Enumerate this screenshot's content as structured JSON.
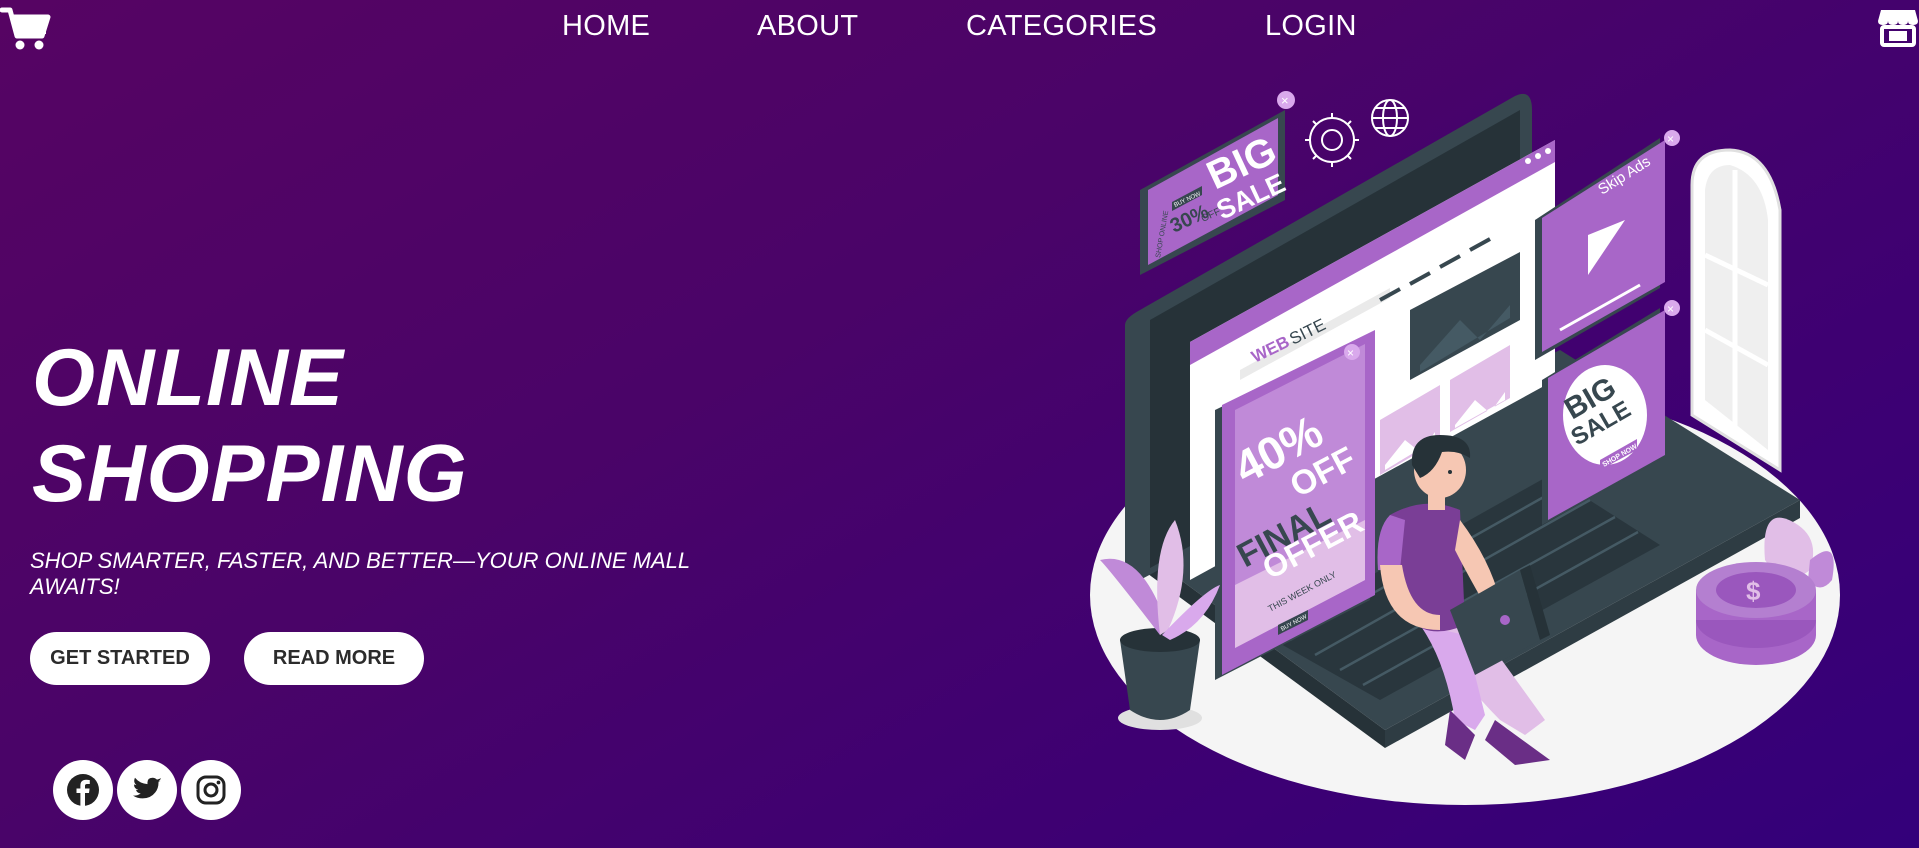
{
  "nav": {
    "home": "HOME",
    "about": "ABOUT",
    "categories": "CATEGORIES",
    "login": "LOGIN"
  },
  "hero": {
    "title_line1": "ONLINE",
    "title_line2": "SHOPPING",
    "tagline": "SHOP SMARTER, FASTER, AND BETTER—YOUR ONLINE MALL AWAITS!",
    "get_started": "GET STARTED",
    "read_more": "READ MORE"
  },
  "illustration": {
    "top_ad_big": "BIG",
    "top_ad_sale": "SALE",
    "top_ad_buy": "BUY NOW",
    "top_ad_percent": "30%",
    "top_ad_off": "OFF",
    "top_ad_side": "SHOP ONLINE",
    "browser_label_web": "WEB",
    "browser_label_site": "SITE",
    "skip_ads": "Skip Ads",
    "offer_percent": "40%",
    "offer_off": "OFF",
    "offer_final": "FINAL",
    "offer_word": "OFFER",
    "offer_week": "THIS WEEK ONLY",
    "offer_buy": "BUY NOW",
    "badge_big": "BIG",
    "badge_sale": "SALE",
    "badge_shop": "SHOP NOW",
    "coin_symbol": "$"
  },
  "icons": {
    "cart": "cart-icon",
    "store": "store-icon",
    "facebook": "facebook-icon",
    "twitter": "twitter-icon",
    "instagram": "instagram-icon"
  },
  "colors": {
    "background_start": "#560463",
    "background_end": "#33007a",
    "accent_purple": "#a866c8",
    "dark_slate": "#37474f"
  }
}
